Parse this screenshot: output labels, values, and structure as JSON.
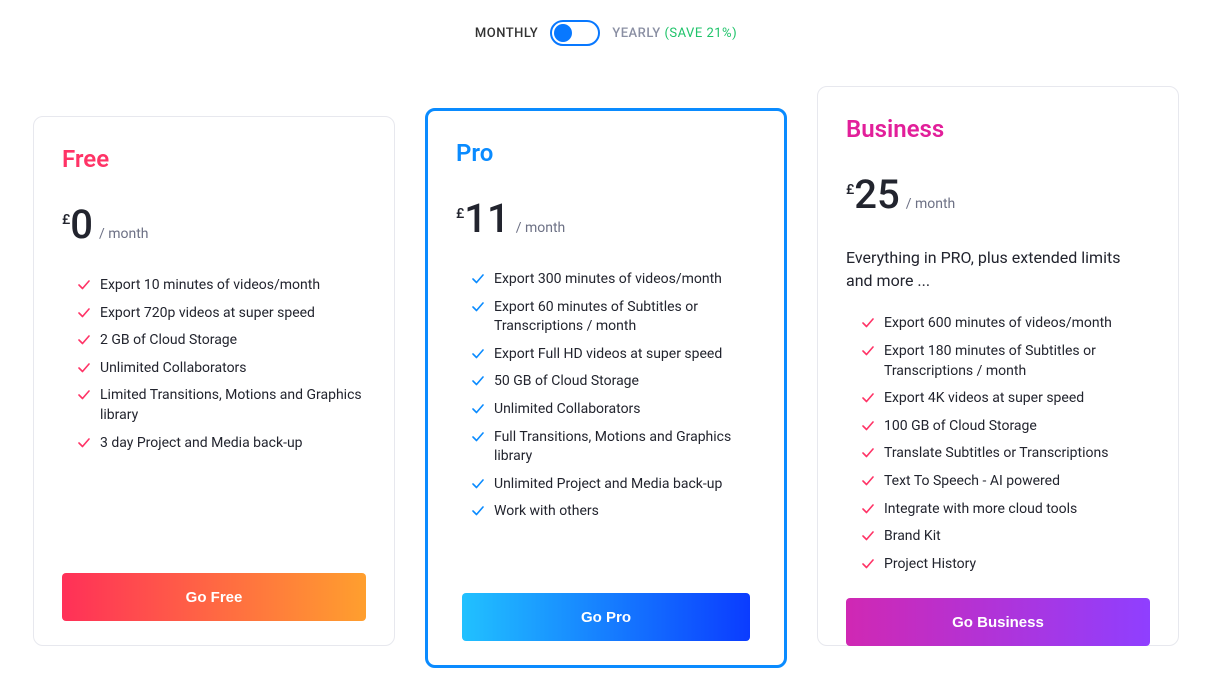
{
  "toggle": {
    "monthly_label": "MONTHLY",
    "yearly_label": "YEARLY",
    "save_text": "(SAVE 21%)",
    "active": "monthly"
  },
  "plans": [
    {
      "id": "free",
      "name": "Free",
      "currency": "£",
      "price": "0",
      "period": "/ month",
      "subtitle": "",
      "features": [
        "Export 10 minutes of videos/month",
        "Export 720p videos at super speed",
        "2 GB of Cloud Storage",
        "Unlimited Collaborators",
        "Limited Transitions, Motions and Graphics library",
        "3 day Project and Media back-up"
      ],
      "cta": "Go Free"
    },
    {
      "id": "pro",
      "name": "Pro",
      "currency": "£",
      "price": "11",
      "period": "/ month",
      "subtitle": "",
      "features": [
        "Export 300 minutes of videos/month",
        "Export 60 minutes of Subtitles or Transcriptions / month",
        "Export Full HD videos at super speed",
        "50 GB of Cloud Storage",
        "Unlimited Collaborators",
        "Full Transitions, Motions and Graphics library",
        "Unlimited Project and Media back-up",
        "Work with others"
      ],
      "cta": "Go Pro"
    },
    {
      "id": "business",
      "name": "Business",
      "currency": "£",
      "price": "25",
      "period": "/ month",
      "subtitle": "Everything in PRO, plus extended limits and more ...",
      "features": [
        "Export 600 minutes of videos/month",
        "Export 180 minutes of Subtitles or Transcriptions / month",
        "Export 4K videos at super speed",
        "100 GB of Cloud Storage",
        "Translate Subtitles or Transcriptions",
        "Text To Speech - AI powered",
        "Integrate with more cloud tools",
        "Brand Kit",
        "Project History"
      ],
      "cta": "Go Business"
    }
  ]
}
